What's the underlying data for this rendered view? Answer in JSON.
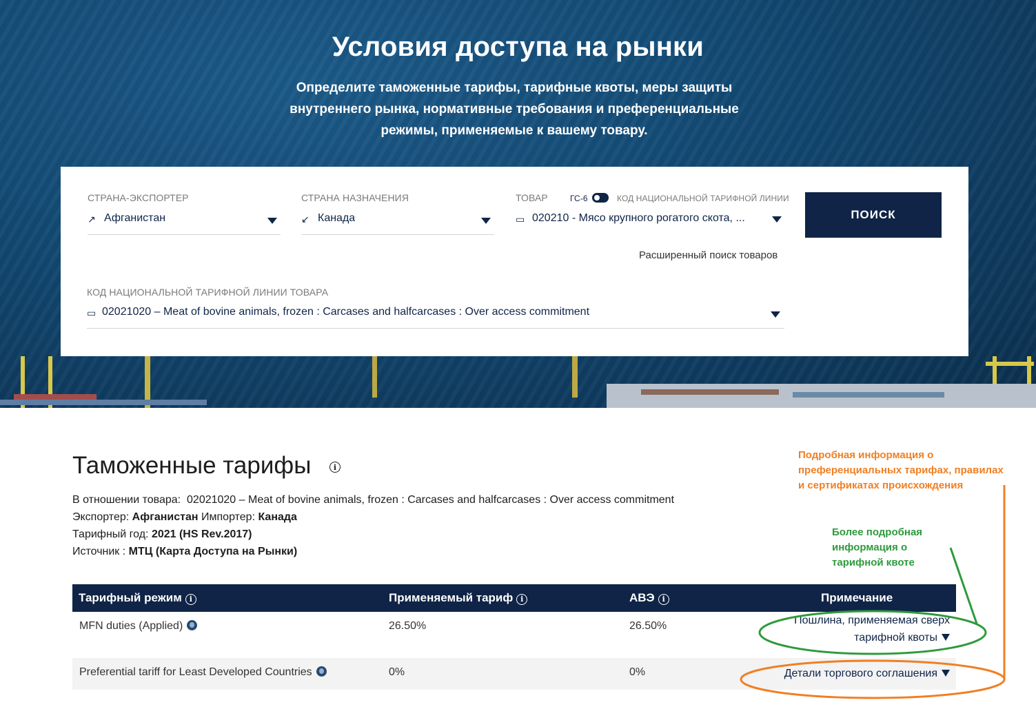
{
  "hero": {
    "title": "Условия доступа на рынки",
    "subtitle": "Определите таможенные тарифы, тарифные квоты, меры защиты внутреннего рынка, нормативные требования и преференциальные режимы, применяемые к вашему товару."
  },
  "search": {
    "exporter": {
      "label": "СТРАНА-ЭКСПОРТЕР",
      "value": "Афганистан"
    },
    "destination": {
      "label": "СТРАНА НАЗНАЧЕНИЯ",
      "value": "Канада"
    },
    "product": {
      "label": "ТОВАР",
      "toggle_left": "ГС-6",
      "toggle_right": "КОД НАЦИОНАЛЬНОЙ ТАРИФНОЙ ЛИНИИ",
      "value": "020210 - Мясо крупного рогатого скота, ..."
    },
    "button": "ПОИСК",
    "advanced_link": "Расширенный поиск товаров",
    "national_line": {
      "label": "КОД НАЦИОНАЛЬНОЙ ТАРИФНОЙ ЛИНИИ ТОВАРА",
      "value": "02021020 – Meat of bovine animals, frozen : Carcases and halfcarcases : Over access commitment"
    }
  },
  "tariffs": {
    "title": "Таможенные тарифы",
    "product_label": "В отношении товара:",
    "product_value": "02021020 – Meat of bovine animals, frozen : Carcases and halfcarcases : Over access commitment",
    "exporter_label": "Экспортер:",
    "exporter_value": "Афганистан",
    "importer_label": "Импортер:",
    "importer_value": "Канада",
    "year_label": "Тарифный год:",
    "year_value": "2021 (HS Rev.2017)",
    "source_label": "Источник :",
    "source_value": "МТЦ (Карта Доступа на Рынки)",
    "columns": [
      "Тарифный режим",
      "Применяемый тариф",
      "АВЭ",
      "Примечание"
    ],
    "rows": [
      {
        "regime": "MFN duties (Applied)",
        "applied": "26.50%",
        "ave": "26.50%",
        "note_line1": "Пошлина, применяемая сверх",
        "note_line2": "тарифной квоты"
      },
      {
        "regime": "Preferential tariff for Least Developed Countries",
        "applied": "0%",
        "ave": "0%",
        "note_line1": "Детали торгового соглашения"
      }
    ]
  },
  "annotations": {
    "orange": [
      "Подробная информация о",
      "преференциальных тарифах, правилах",
      "и сертификатах происхождения"
    ],
    "green": [
      "Более подробная",
      "информация о",
      "тарифной квоте"
    ],
    "orange_color": "#f07f22",
    "green_color": "#2e9a3c"
  },
  "colors": {
    "navy": "#0f2447",
    "hero_blue": "#134a74"
  }
}
